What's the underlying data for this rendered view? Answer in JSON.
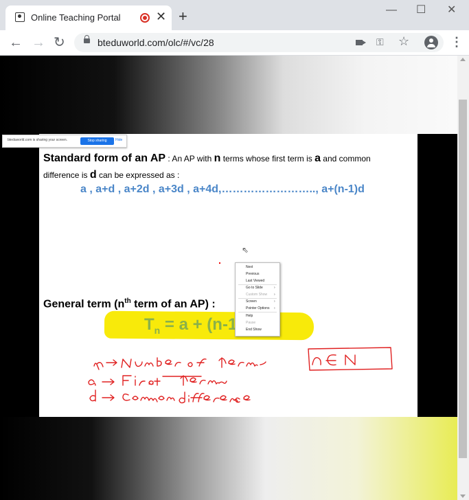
{
  "browser": {
    "tab_title": "Online Teaching Portal",
    "tab_close": "✕",
    "new_tab": "+",
    "url": "bteduworld.com/olc/#/vc/28",
    "window_controls": {
      "minimize": "—",
      "maximize": "☐",
      "close": "✕"
    },
    "nav": {
      "back": "←",
      "forward": "→",
      "reload": "↻"
    },
    "icons": [
      "recording-icon",
      "camera-icon",
      "key-icon",
      "star-icon",
      "profile-icon",
      "menu-icon"
    ]
  },
  "share_bar": {
    "text": "bteduworld.com is sharing your screen.",
    "stop_label": "Stop sharing",
    "hide_label": "Hide"
  },
  "slide": {
    "title_bold": "Standard form of an AP",
    "title_rest_1": " : An AP with ",
    "n_letter": "n",
    "title_rest_2": " terms whose first term is ",
    "a_letter": "a",
    "title_rest_3": " and common",
    "line2_1": "difference is ",
    "d_letter": "d",
    "line2_2": " can be expressed as :",
    "sequence": "a , a+d , a+2d , a+3d , a+4d,…………………….., a+(n-1)d",
    "general_term_pre": "General term (n",
    "general_term_sup": "th",
    "general_term_post": " term of an AP) :",
    "formula_t": "T",
    "formula_sub": "n",
    "formula_rest": " = a + (n-1)d"
  },
  "context_menu": {
    "items": [
      {
        "label": "Next",
        "disabled": false,
        "submenu": false
      },
      {
        "label": "Previous",
        "disabled": false,
        "submenu": false
      },
      {
        "label": "Last Viewed",
        "disabled": false,
        "submenu": false
      },
      {
        "label": "Go to Slide",
        "disabled": false,
        "submenu": true
      },
      {
        "label": "Custom Show",
        "disabled": true,
        "submenu": true
      },
      {
        "label": "Screen",
        "disabled": false,
        "submenu": true
      },
      {
        "label": "Pointer Options",
        "disabled": false,
        "submenu": true
      },
      {
        "label": "Help",
        "disabled": false,
        "submenu": false
      },
      {
        "label": "Pause",
        "disabled": true,
        "submenu": false
      },
      {
        "label": "End Show",
        "disabled": false,
        "submenu": false
      }
    ]
  },
  "annotations": {
    "line1": "n → Number of terms",
    "line2": "a → First term",
    "line3": "d → Common difference",
    "boxed": "n ∈ N",
    "ink_color": "#e02020"
  },
  "colors": {
    "sequence": "#4a86c8",
    "formula": "#8ab14a",
    "highlight": "#f8ea0a",
    "stop_button": "#1a73e8"
  }
}
